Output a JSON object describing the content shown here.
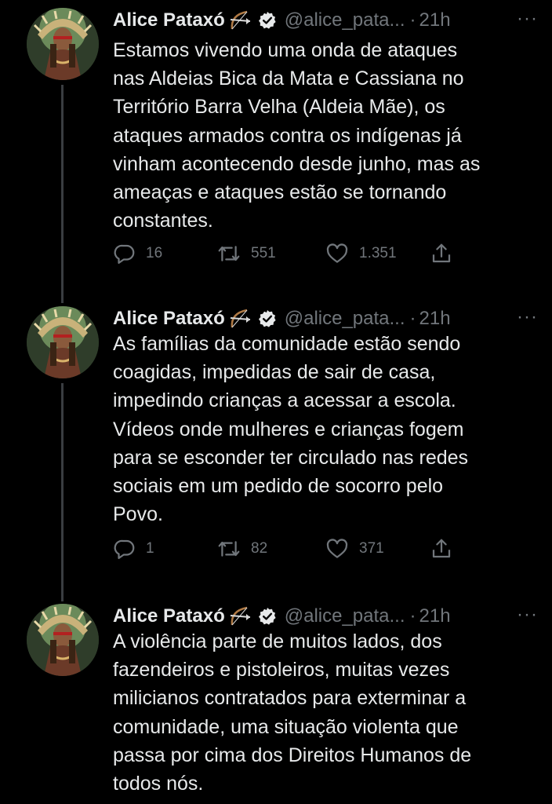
{
  "colors": {
    "background": "#000000",
    "text": "#e7e9ea",
    "muted": "#71767b",
    "thread_line": "#3a3d41",
    "verified_badge": "#e7e9ea"
  },
  "tweets": [
    {
      "author_name": "Alice Pataxó",
      "emoji": "🏹",
      "handle": "@alice_pata...",
      "separator": "·",
      "time": "21h",
      "more": "···",
      "lines": [
        "Estamos vivendo uma onda de ataques",
        "nas Aldeias Bica da Mata e Cassiana no",
        "Território Barra Velha (Aldeia Mãe), os",
        "ataques armados contra os indígenas já",
        "vinham acontecendo desde junho, mas as",
        "ameaças e ataques estão se tornando",
        "constantes."
      ],
      "replies": "16",
      "retweets": "551",
      "likes": "1.351"
    },
    {
      "author_name": "Alice Pataxó",
      "emoji": "🏹",
      "handle": "@alice_pata...",
      "separator": "·",
      "time": "21h",
      "more": "···",
      "lines": [
        "As famílias da comunidade estão sendo",
        "coagidas, impedidas de sair de casa,",
        "impedindo crianças a acessar a escola.",
        "Vídeos onde mulheres e crianças fogem",
        "para se esconder ter circulado nas redes",
        "sociais em um pedido de socorro pelo",
        "Povo."
      ],
      "replies": "1",
      "retweets": "82",
      "likes": "371"
    },
    {
      "author_name": "Alice Pataxó",
      "emoji": "🏹",
      "handle": "@alice_pata...",
      "separator": "·",
      "time": "21h",
      "more": "···",
      "lines": [
        "A violência parte de muitos lados, dos",
        "fazendeiros e pistoleiros, muitas vezes",
        "milicianos contratados para exterminar a",
        "comunidade, uma situação violenta que",
        "passa por cima dos Direitos Humanos de",
        "todos  nós."
      ]
    }
  ]
}
